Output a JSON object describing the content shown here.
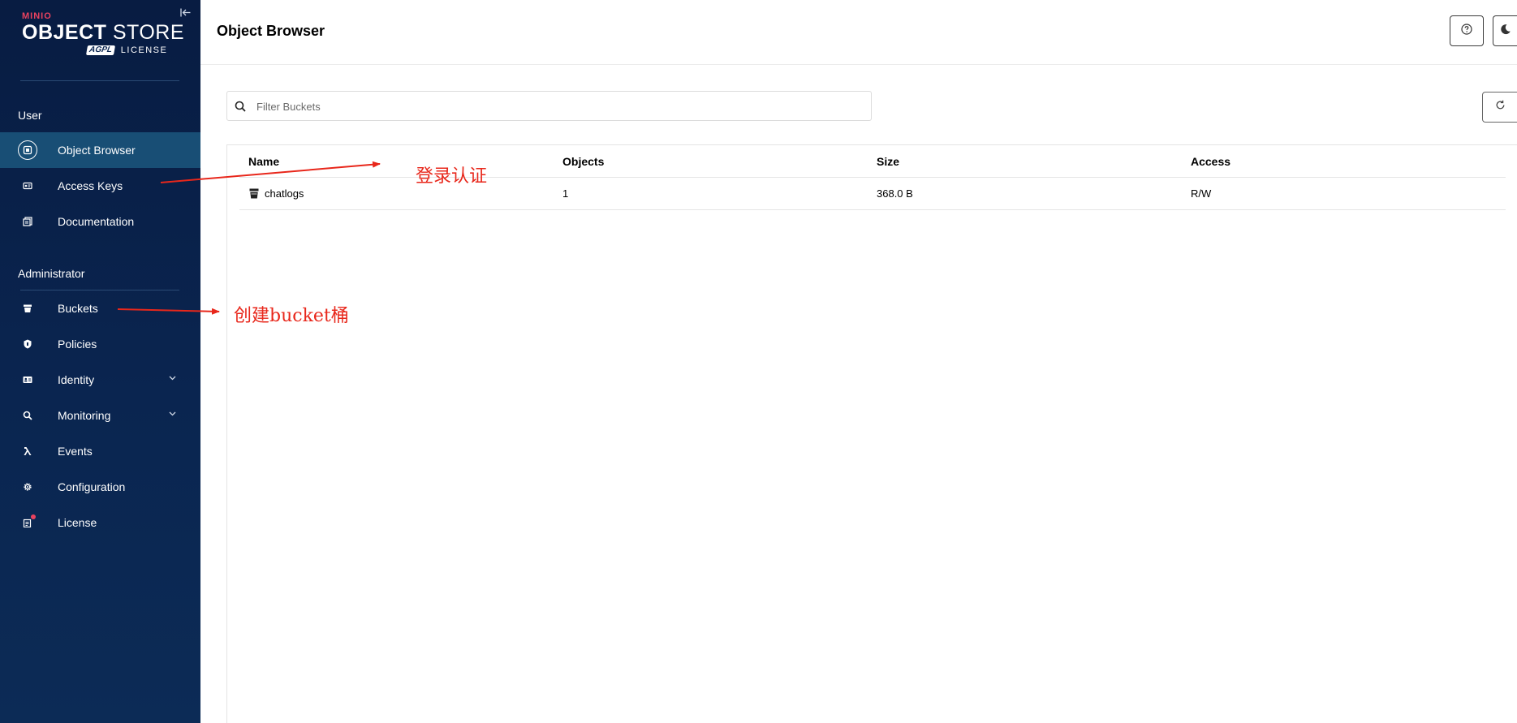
{
  "app": {
    "brand": "MINIO",
    "product_bold": "OBJECT",
    "product_thin": "STORE",
    "license_badge": "AGPL",
    "license_text": "LICENSE"
  },
  "sidebar": {
    "user_section": "User",
    "admin_section": "Administrator",
    "user_items": [
      {
        "label": "Object Browser",
        "icon": "object-browser-icon"
      },
      {
        "label": "Access Keys",
        "icon": "key-icon"
      },
      {
        "label": "Documentation",
        "icon": "docs-icon"
      }
    ],
    "admin_items": [
      {
        "label": "Buckets",
        "icon": "bucket-icon"
      },
      {
        "label": "Policies",
        "icon": "shield-icon"
      },
      {
        "label": "Identity",
        "icon": "identity-icon"
      },
      {
        "label": "Monitoring",
        "icon": "monitor-search-icon"
      },
      {
        "label": "Events",
        "icon": "lambda-icon"
      },
      {
        "label": "Configuration",
        "icon": "gear-icon"
      },
      {
        "label": "License",
        "icon": "license-icon"
      }
    ]
  },
  "header": {
    "title": "Object Browser"
  },
  "filter": {
    "placeholder": "Filter Buckets"
  },
  "table": {
    "columns": [
      "Name",
      "Objects",
      "Size",
      "Access"
    ],
    "rows": [
      {
        "name": "chatlogs",
        "objects": "1",
        "size": "368.0 B",
        "access": "R/W"
      }
    ]
  },
  "annotations": {
    "login": "登录认证",
    "create_bucket": "创建bucket桶",
    "color": "#e8271b"
  },
  "colors": {
    "sidebar_bg": "#0a2550",
    "sidebar_active": "#184e75",
    "brand_red": "#e9425f"
  }
}
